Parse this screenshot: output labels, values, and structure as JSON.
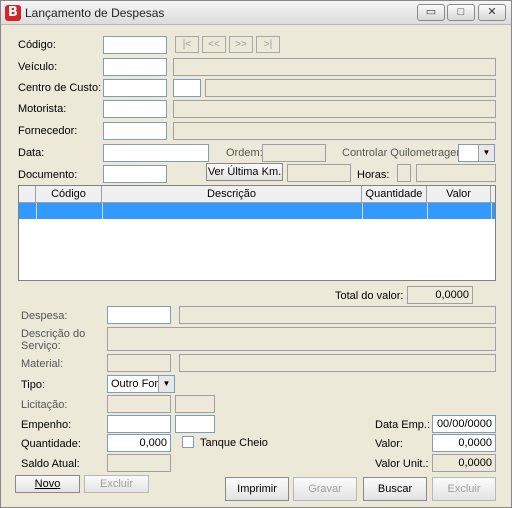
{
  "window": {
    "title": "Lançamento de Despesas",
    "icon_letter": "B",
    "minimize": "▭",
    "maximize": "□",
    "close": "✕"
  },
  "labels": {
    "codigo": "Código:",
    "veiculo": "Veículo:",
    "centro_custo": "Centro de Custo:",
    "motorista": "Motorista:",
    "fornecedor": "Fornecedor:",
    "data": "Data:",
    "ordem": "Ordem:",
    "controlar_quilometragem": "Controlar Quilometragem:",
    "documento": "Documento:",
    "horas": "Horas:",
    "total_valor": "Total do valor:",
    "despesa": "Despesa:",
    "descricao_servico_1": "Descrição do",
    "descricao_servico_2": "Serviço:",
    "material": "Material:",
    "tipo": "Tipo:",
    "licitacao": "Licitação:",
    "empenho": "Empenho:",
    "quantidade": "Quantidade:",
    "tanque_cheio": "Tanque Cheio",
    "saldo_atual": "Saldo Atual:",
    "data_emp": "Data Emp.:",
    "valor": "Valor:",
    "valor_unit": "Valor Unit.:"
  },
  "nav": {
    "first": "|<",
    "prev": "<<",
    "next": ">>",
    "last": ">|"
  },
  "buttons": {
    "ver_ultima_km": "Ver Última Km.",
    "novo": "Novo",
    "excluir_item": "Excluir",
    "imprimir": "Imprimir",
    "gravar": "Gravar",
    "buscar": "Buscar",
    "excluir": "Excluir"
  },
  "grid": {
    "columns": [
      "Código",
      "Descrição",
      "Quantidade",
      "Valor"
    ]
  },
  "values": {
    "total_valor": "0,0000",
    "tipo": "Outro Forn",
    "quantidade": "0,000",
    "data_emp": "00/00/0000",
    "valor": "0,0000",
    "valor_unit": "0,0000"
  }
}
